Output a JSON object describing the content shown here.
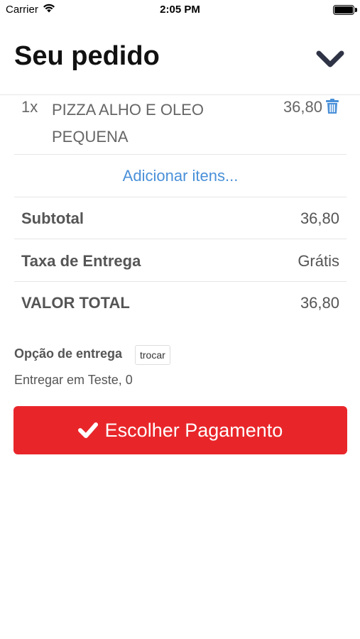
{
  "status_bar": {
    "carrier": "Carrier",
    "time": "2:05 PM"
  },
  "header": {
    "title": "Seu pedido",
    "collapse_icon": "chevron-down-icon"
  },
  "order_items": [
    {
      "quantity": "1x",
      "name": "PIZZA ALHO E OLEO PEQUENA",
      "price": "36,80",
      "delete_icon": "trash-icon"
    }
  ],
  "add_items_label": "Adicionar itens...",
  "summary": {
    "subtotal_label": "Subtotal",
    "subtotal_value": "36,80",
    "delivery_fee_label": "Taxa de Entrega",
    "delivery_fee_value": "Grátis",
    "total_label": "VALOR TOTAL",
    "total_value": "36,80"
  },
  "delivery": {
    "title": "Opção de entrega",
    "change_label": "trocar",
    "address": "Entregar em Teste, 0"
  },
  "payment_button": {
    "label": "Escolher Pagamento",
    "icon": "check-icon"
  },
  "colors": {
    "accent_red": "#e8262a",
    "link_blue": "#4a90d9",
    "chevron": "#2f3346"
  }
}
